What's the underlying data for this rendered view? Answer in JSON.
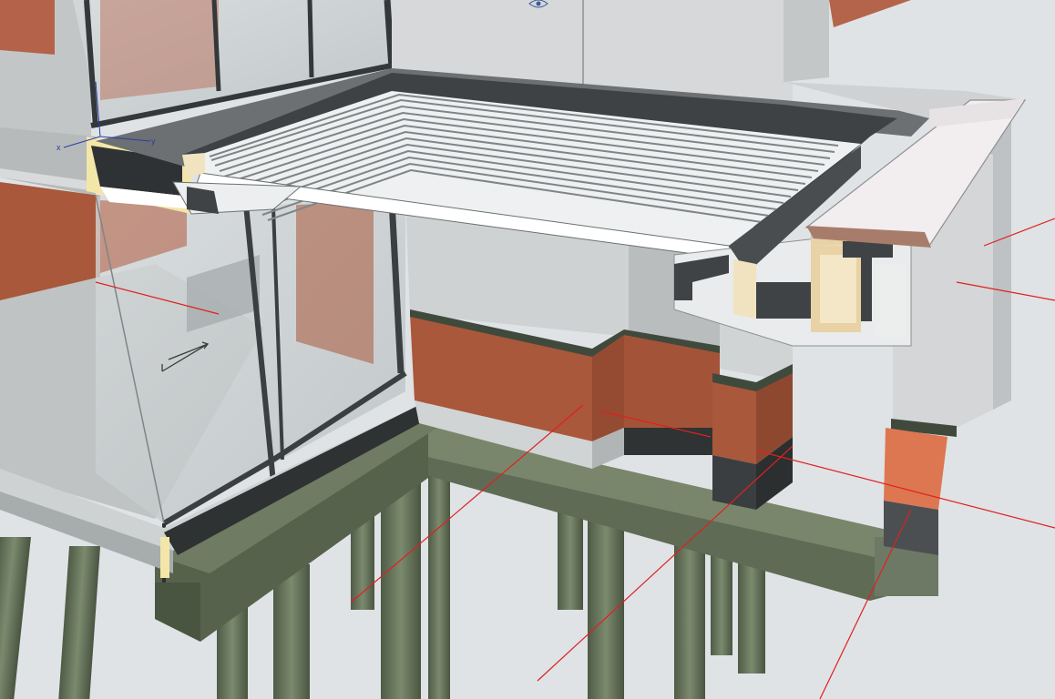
{
  "viewport": {
    "view_type": "3D axonometric section view",
    "background": "#dfe3e6"
  },
  "colors": {
    "brick": "#a9583b",
    "brick_light": "#dd7751",
    "plaster": "#d9dadb",
    "plaster_dark": "#bfc2c4",
    "concrete_green": "#66735c",
    "concrete_green_dark": "#4c5745",
    "membrane": "#4a4d4f",
    "timber": "#e8d2a6",
    "glass": "#c9ced0",
    "section_line": "#e02020",
    "corrugated_roof": "#eef0f1"
  },
  "axis_labels": {
    "x": "x",
    "y": "y"
  },
  "icons": [
    "eye-icon",
    "section-arrow-icon",
    "axis-gizmo-icon"
  ]
}
